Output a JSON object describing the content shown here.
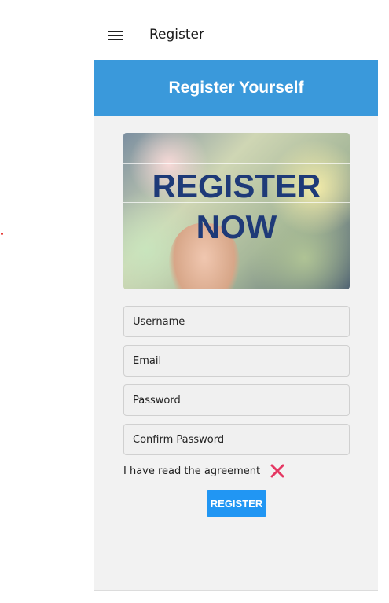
{
  "appbar": {
    "title": "Register",
    "menu_icon": "hamburger-menu-icon"
  },
  "banner": {
    "title": "Register Yourself"
  },
  "hero": {
    "line1": "REGISTER",
    "line2": "NOW"
  },
  "form": {
    "username_placeholder": "Username",
    "email_placeholder": "Email",
    "password_placeholder": "Password",
    "confirm_password_placeholder": "Confirm Password",
    "agreement_label": "I have read the agreement",
    "agreement_icon": "close-x-icon",
    "agreement_icon_color": "#e53762",
    "register_label": "REGISTER"
  },
  "colors": {
    "banner": "#3a99db",
    "button": "#2196f3"
  }
}
